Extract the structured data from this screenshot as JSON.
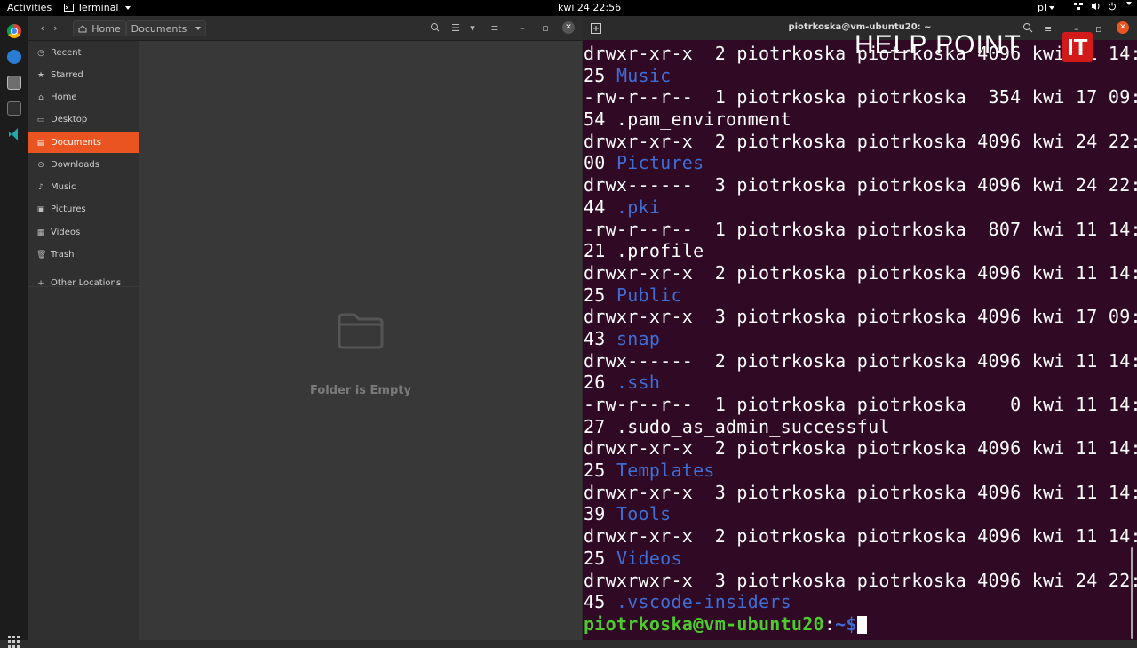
{
  "topbar": {
    "activities": "Activities",
    "app_name": "Terminal",
    "clock": "kwi 24  22:56",
    "language": "pl"
  },
  "file_manager": {
    "breadcrumb_home": "Home",
    "breadcrumb_documents": "Documents",
    "sidebar": [
      {
        "label": "Recent",
        "icon": "clock-icon"
      },
      {
        "label": "Starred",
        "icon": "star-icon"
      },
      {
        "label": "Home",
        "icon": "home-icon"
      },
      {
        "label": "Desktop",
        "icon": "desktop-icon"
      },
      {
        "label": "Documents",
        "icon": "document-icon"
      },
      {
        "label": "Downloads",
        "icon": "download-icon"
      },
      {
        "label": "Music",
        "icon": "music-icon"
      },
      {
        "label": "Pictures",
        "icon": "picture-icon"
      },
      {
        "label": "Videos",
        "icon": "video-icon"
      },
      {
        "label": "Trash",
        "icon": "trash-icon"
      },
      {
        "label": "Other Locations",
        "icon": "plus-icon"
      }
    ],
    "empty_message": "Folder is Empty"
  },
  "terminal": {
    "title": "piotrkoska@vm-ubuntu20: ~",
    "lines": [
      [
        "drwxr-xr-x  2 piotrkoska piotrkoska 4096 kwi 11 14:",
        ""
      ],
      [
        "25 ",
        "Music"
      ],
      [
        "-rw-r--r--  1 piotrkoska piotrkoska  354 kwi 17 09:",
        ""
      ],
      [
        "54 .pam_environment",
        ""
      ],
      [
        "drwxr-xr-x  2 piotrkoska piotrkoska 4096 kwi 24 22:",
        ""
      ],
      [
        "00 ",
        "Pictures"
      ],
      [
        "drwx------  3 piotrkoska piotrkoska 4096 kwi 24 22:",
        ""
      ],
      [
        "44 ",
        ".pki"
      ],
      [
        "-rw-r--r--  1 piotrkoska piotrkoska  807 kwi 11 14:",
        ""
      ],
      [
        "21 .profile",
        ""
      ],
      [
        "drwxr-xr-x  2 piotrkoska piotrkoska 4096 kwi 11 14:",
        ""
      ],
      [
        "25 ",
        "Public"
      ],
      [
        "drwxr-xr-x  3 piotrkoska piotrkoska 4096 kwi 17 09:",
        ""
      ],
      [
        "43 ",
        "snap"
      ],
      [
        "drwx------  2 piotrkoska piotrkoska 4096 kwi 11 14:",
        ""
      ],
      [
        "26 ",
        ".ssh"
      ],
      [
        "-rw-r--r--  1 piotrkoska piotrkoska    0 kwi 11 14:",
        ""
      ],
      [
        "27 .sudo_as_admin_successful",
        ""
      ],
      [
        "drwxr-xr-x  2 piotrkoska piotrkoska 4096 kwi 11 14:",
        ""
      ],
      [
        "25 ",
        "Templates"
      ],
      [
        "drwxr-xr-x  3 piotrkoska piotrkoska 4096 kwi 11 14:",
        ""
      ],
      [
        "39 ",
        "Tools"
      ],
      [
        "drwxr-xr-x  2 piotrkoska piotrkoska 4096 kwi 11 14:",
        ""
      ],
      [
        "25 ",
        "Videos"
      ],
      [
        "drwxrwxr-x  3 piotrkoska piotrkoska 4096 kwi 24 22:",
        ""
      ],
      [
        "45 ",
        ".vscode-insiders"
      ]
    ],
    "prompt_user": "piotrkoska@vm-ubuntu20",
    "prompt_sep": ":",
    "prompt_path": "~$"
  },
  "watermark": {
    "text": "HELP POINT",
    "logo_text": "IT"
  },
  "colors": {
    "accent": "#e95420",
    "terminal_bg": "#300a24",
    "directory": "#3f6dd6",
    "prompt_user": "#4ec92f"
  }
}
